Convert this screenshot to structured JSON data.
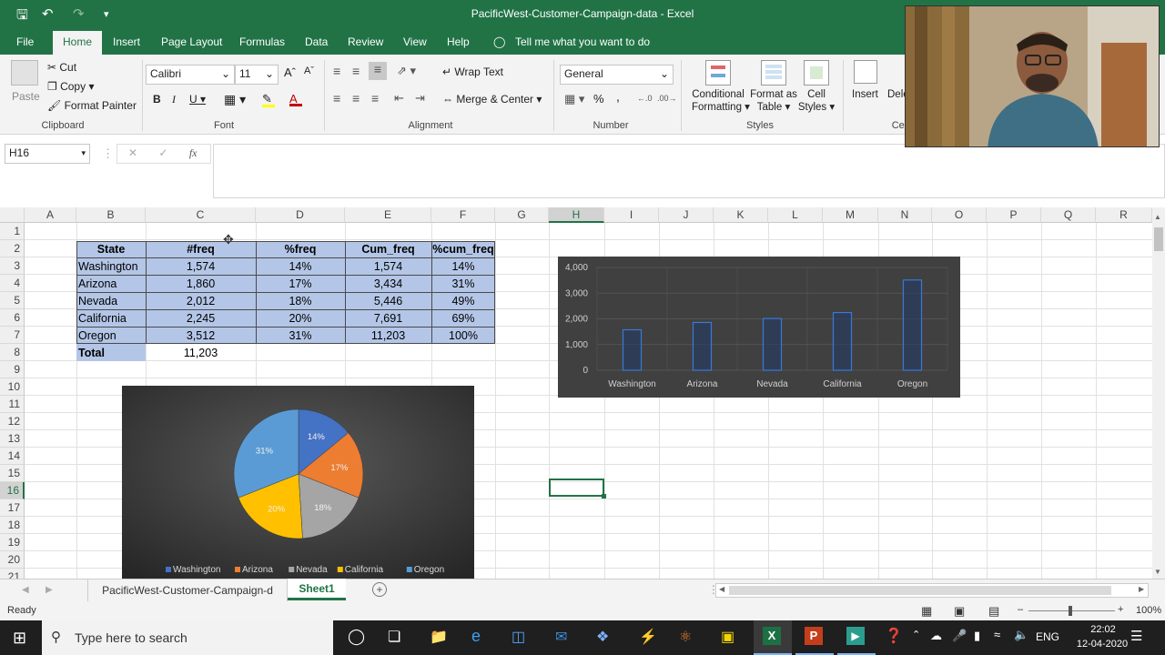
{
  "window": {
    "title": "PacificWest-Customer-Campaign-data  -  Excel"
  },
  "tabs": [
    "File",
    "Home",
    "Insert",
    "Page Layout",
    "Formulas",
    "Data",
    "Review",
    "View",
    "Help"
  ],
  "tell_me": "Tell me what you want to do",
  "clipboard": {
    "paste": "Paste",
    "cut": "Cut",
    "copy": "Copy",
    "format_painter": "Format Painter",
    "group": "Clipboard"
  },
  "font": {
    "name": "Calibri",
    "size": "11",
    "group": "Font"
  },
  "alignment": {
    "wrap": "Wrap Text",
    "merge": "Merge & Center",
    "group": "Alignment"
  },
  "number": {
    "format": "General",
    "percent": "%",
    "comma": ",",
    "group": "Number"
  },
  "styles": {
    "conditional": "Conditional",
    "conditional2": "Formatting",
    "format_as": "Format as",
    "format_as2": "Table",
    "cell_styles": "Cell",
    "cell_styles2": "Styles",
    "group": "Styles"
  },
  "cells": {
    "insert": "Insert",
    "delete": "Dele",
    "group": "Cel"
  },
  "namebox": "H16",
  "fx": "fx",
  "columns": [
    "A",
    "B",
    "C",
    "D",
    "E",
    "F",
    "G",
    "H",
    "I",
    "J",
    "K",
    "L",
    "M",
    "N",
    "O",
    "P",
    "Q",
    "R"
  ],
  "rows": [
    "1",
    "2",
    "3",
    "4",
    "5",
    "6",
    "7",
    "8",
    "9",
    "10",
    "11",
    "12",
    "13",
    "14",
    "15",
    "16",
    "17",
    "18",
    "19",
    "20",
    "21"
  ],
  "table": {
    "headers": [
      "State",
      "#freq",
      "%freq",
      "Cum_freq",
      "%cum_freq"
    ],
    "rows": [
      [
        "Washington",
        "1,574",
        "14%",
        "1,574",
        "14%"
      ],
      [
        "Arizona",
        "1,860",
        "17%",
        "3,434",
        "31%"
      ],
      [
        "Nevada",
        "2,012",
        "18%",
        "5,446",
        "49%"
      ],
      [
        "California",
        "2,245",
        "20%",
        "7,691",
        "69%"
      ],
      [
        "Oregon",
        "3,512",
        "31%",
        "11,203",
        "100%"
      ]
    ],
    "total_label": "Total",
    "total_value": "11,203"
  },
  "chart_data": [
    {
      "type": "pie",
      "categories": [
        "Washington",
        "Arizona",
        "Nevada",
        "California",
        "Oregon"
      ],
      "values": [
        14,
        17,
        18,
        20,
        31
      ],
      "labels": [
        "14%",
        "17%",
        "18%",
        "20%",
        "31%"
      ],
      "colors": [
        "#4472c4",
        "#ed7d31",
        "#a5a5a5",
        "#ffc000",
        "#5b9bd5"
      ],
      "legend": "bottom"
    },
    {
      "type": "bar",
      "categories": [
        "Washington",
        "Arizona",
        "Nevada",
        "California",
        "Oregon"
      ],
      "values": [
        1574,
        1860,
        2012,
        2245,
        3512
      ],
      "ylim": [
        0,
        4000
      ],
      "yticks": [
        "0",
        "1,000",
        "2,000",
        "3,000",
        "4,000"
      ],
      "grid": true
    }
  ],
  "sheets": {
    "tab1": "PacificWest-Customer-Campaign-d",
    "tab2": "Sheet1"
  },
  "status": {
    "ready": "Ready",
    "zoom": "100%"
  },
  "taskbar": {
    "search": "Type here to search",
    "lang": "ENG",
    "time": "22:02",
    "date": "12-04-2020"
  }
}
